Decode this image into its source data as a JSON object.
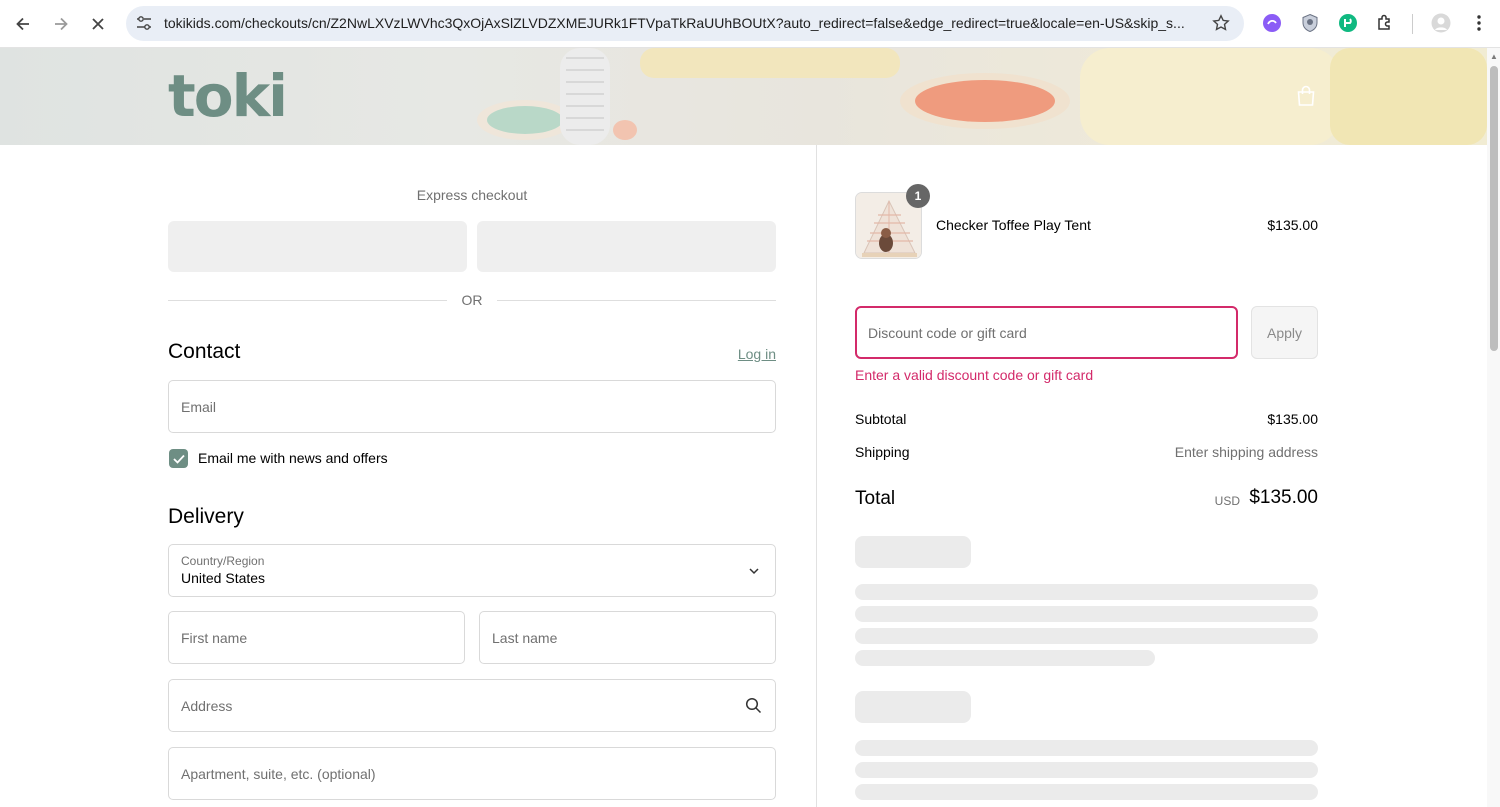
{
  "browser": {
    "url": "tokikids.com/checkouts/cn/Z2NwLXVzLWVhc3QxOjAxSlZLVDZXMEJURk1FTVpaTkRaUUhBOUtX?auto_redirect=false&edge_redirect=true&locale=en-US&skip_s...",
    "icons": [
      "back-icon",
      "forward-icon",
      "stop-loading-icon",
      "site-info-icon",
      "bookmark-star-icon",
      "extension-purple-icon",
      "extension-shield-icon",
      "extension-green-icon",
      "extensions-puzzle-icon",
      "profile-avatar-icon",
      "more-menu-icon"
    ]
  },
  "header": {
    "logo_text": "toki",
    "cart_icon": "shopping-bag-icon"
  },
  "express": {
    "label": "Express checkout",
    "divider_text": "OR"
  },
  "contact": {
    "title": "Contact",
    "login_link": "Log in",
    "email_placeholder": "Email",
    "newsletter_label": "Email me with news and offers",
    "newsletter_checked": true
  },
  "delivery": {
    "title": "Delivery",
    "country_label": "Country/Region",
    "country_value": "United States",
    "first_name_placeholder": "First name",
    "last_name_placeholder": "Last name",
    "address_placeholder": "Address",
    "apartment_placeholder": "Apartment, suite, etc. (optional)"
  },
  "summary": {
    "item": {
      "quantity": "1",
      "name": "Checker Toffee Play Tent",
      "price": "$135.00"
    },
    "discount_placeholder": "Discount code or gift card",
    "apply_label": "Apply",
    "discount_error": "Enter a valid discount code or gift card",
    "subtotal_label": "Subtotal",
    "subtotal_value": "$135.00",
    "shipping_label": "Shipping",
    "shipping_value": "Enter shipping address",
    "total_label": "Total",
    "total_currency": "USD",
    "total_value": "$135.00"
  },
  "colors": {
    "brand": "#6e8e84",
    "error": "#d32a6a",
    "skeleton": "#ebebeb"
  }
}
